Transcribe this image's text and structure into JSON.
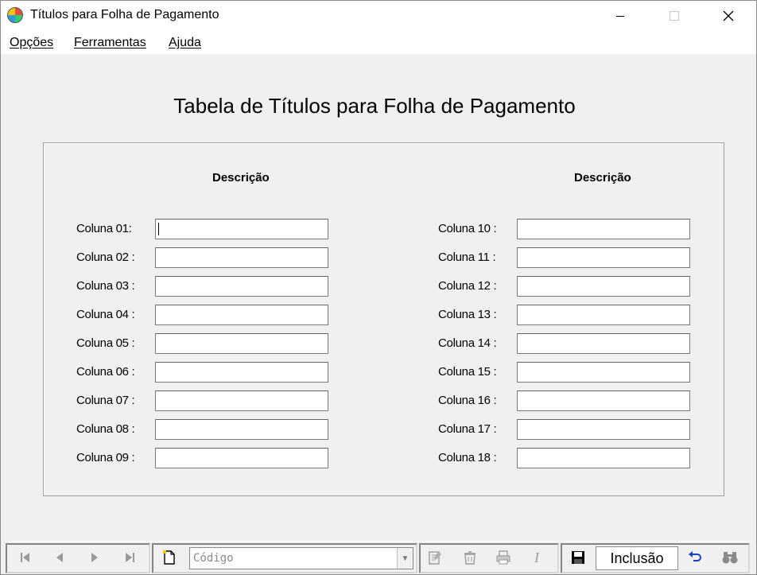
{
  "window": {
    "title": "Títulos para Folha de Pagamento"
  },
  "menu": [
    {
      "label": "Opções"
    },
    {
      "label": "Ferramentas"
    },
    {
      "label": "Ajuda"
    }
  ],
  "form": {
    "title": "Tabela de Títulos para Folha de Pagamento",
    "left_header": "Descrição",
    "right_header": "Descrição",
    "left_rows": [
      {
        "label": "Coluna 01:",
        "value": ""
      },
      {
        "label": "Coluna 02 :",
        "value": ""
      },
      {
        "label": "Coluna 03 :",
        "value": ""
      },
      {
        "label": "Coluna 04 :",
        "value": ""
      },
      {
        "label": "Coluna 05 :",
        "value": ""
      },
      {
        "label": "Coluna 06 :",
        "value": ""
      },
      {
        "label": "Coluna 07 :",
        "value": ""
      },
      {
        "label": "Coluna 08 :",
        "value": ""
      },
      {
        "label": "Coluna 09 :",
        "value": ""
      }
    ],
    "right_rows": [
      {
        "label": "Coluna 10 :",
        "value": ""
      },
      {
        "label": "Coluna 11 :",
        "value": ""
      },
      {
        "label": "Coluna 12 :",
        "value": ""
      },
      {
        "label": "Coluna 13 :",
        "value": ""
      },
      {
        "label": "Coluna 14 :",
        "value": ""
      },
      {
        "label": "Coluna 15 :",
        "value": ""
      },
      {
        "label": "Coluna 16 :",
        "value": ""
      },
      {
        "label": "Coluna 17 :",
        "value": ""
      },
      {
        "label": "Coluna 18 :",
        "value": ""
      }
    ]
  },
  "toolbar": {
    "search_placeholder": "Código",
    "mode": "Inclusão"
  },
  "icons": {
    "first": "first-record-icon",
    "prev": "previous-record-icon",
    "next": "next-record-icon",
    "last": "last-record-icon",
    "new": "new-document-icon",
    "edit": "edit-record-icon",
    "delete": "delete-record-icon",
    "print": "print-icon",
    "italic": "italic-icon",
    "save": "save-icon",
    "undo": "undo-icon",
    "find": "binoculars-icon"
  }
}
